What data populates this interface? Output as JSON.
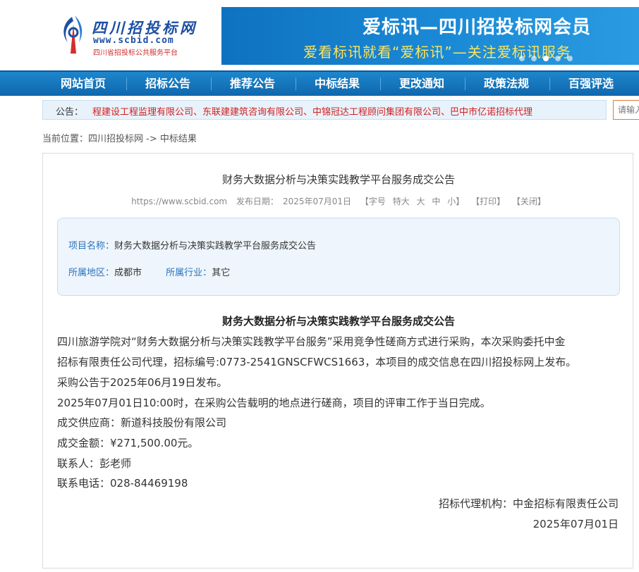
{
  "header": {
    "logo_cn": "四川招投标网",
    "logo_url": "www.scbid.com",
    "logo_sub": "四川省招投标公共服务平台",
    "banner_line1": "爱标讯—四川招投标网会员",
    "banner_line2": "爱看标讯就看“爱标讯”—关注爱标讯服务"
  },
  "nav": {
    "items": [
      "网站首页",
      "招标公告",
      "推荐公告",
      "中标结果",
      "更改通知",
      "政策法规",
      "百强评选"
    ]
  },
  "notice": {
    "label": "公告：",
    "text": "程建设工程监理有限公司、东联建建筑咨询有限公司、中锦冠达工程顾问集团有限公司、巴中市亿诺招标代理"
  },
  "search": {
    "placeholder": "请输入"
  },
  "breadcrumb": {
    "prefix": "当前位置：",
    "home": "四川招投标网",
    "sep": " -> ",
    "current": "中标结果"
  },
  "article": {
    "title": "财务大数据分析与决策实践教学平台服务成交公告",
    "meta": {
      "site": "https://www.scbid.com",
      "date_label": "发布日期：",
      "date": "2025年07月01日",
      "font_label": "【字号",
      "font_xl": "特大",
      "font_l": "大",
      "font_m": "中",
      "font_s": "小】",
      "print": "【打印】",
      "close": "【关闭】"
    },
    "info": {
      "project_label": "项目名称：",
      "project_value": "财务大数据分析与决策实践教学平台服务成交公告",
      "region_label": "所属地区：",
      "region_value": "成都市",
      "industry_label": "所属行业：",
      "industry_value": "其它"
    },
    "heading": "财务大数据分析与决策实践教学平台服务成交公告",
    "paragraphs": [
      "四川旅游学院对“财务大数据分析与决策实践教学平台服务”采用竞争性磋商方式进行采购，本次采购委托中金",
      "招标有限责任公司代理，招标编号:0773-2541GNSCFWCS1663，本项目的成交信息在四川招投标网上发布。",
      "采购公告于2025年06月19日发布。",
      "2025年07月01日10:00时，在采购公告载明的地点进行磋商，项目的评审工作于当日完成。",
      "成交供应商：新道科技股份有限公司",
      "成交金额：¥271,500.00元。",
      "联系人：彭老师",
      "联系电话：028-84469198"
    ],
    "agency": "招标代理机构：中金招标有限责任公司",
    "sign_date": "2025年07月01日"
  }
}
